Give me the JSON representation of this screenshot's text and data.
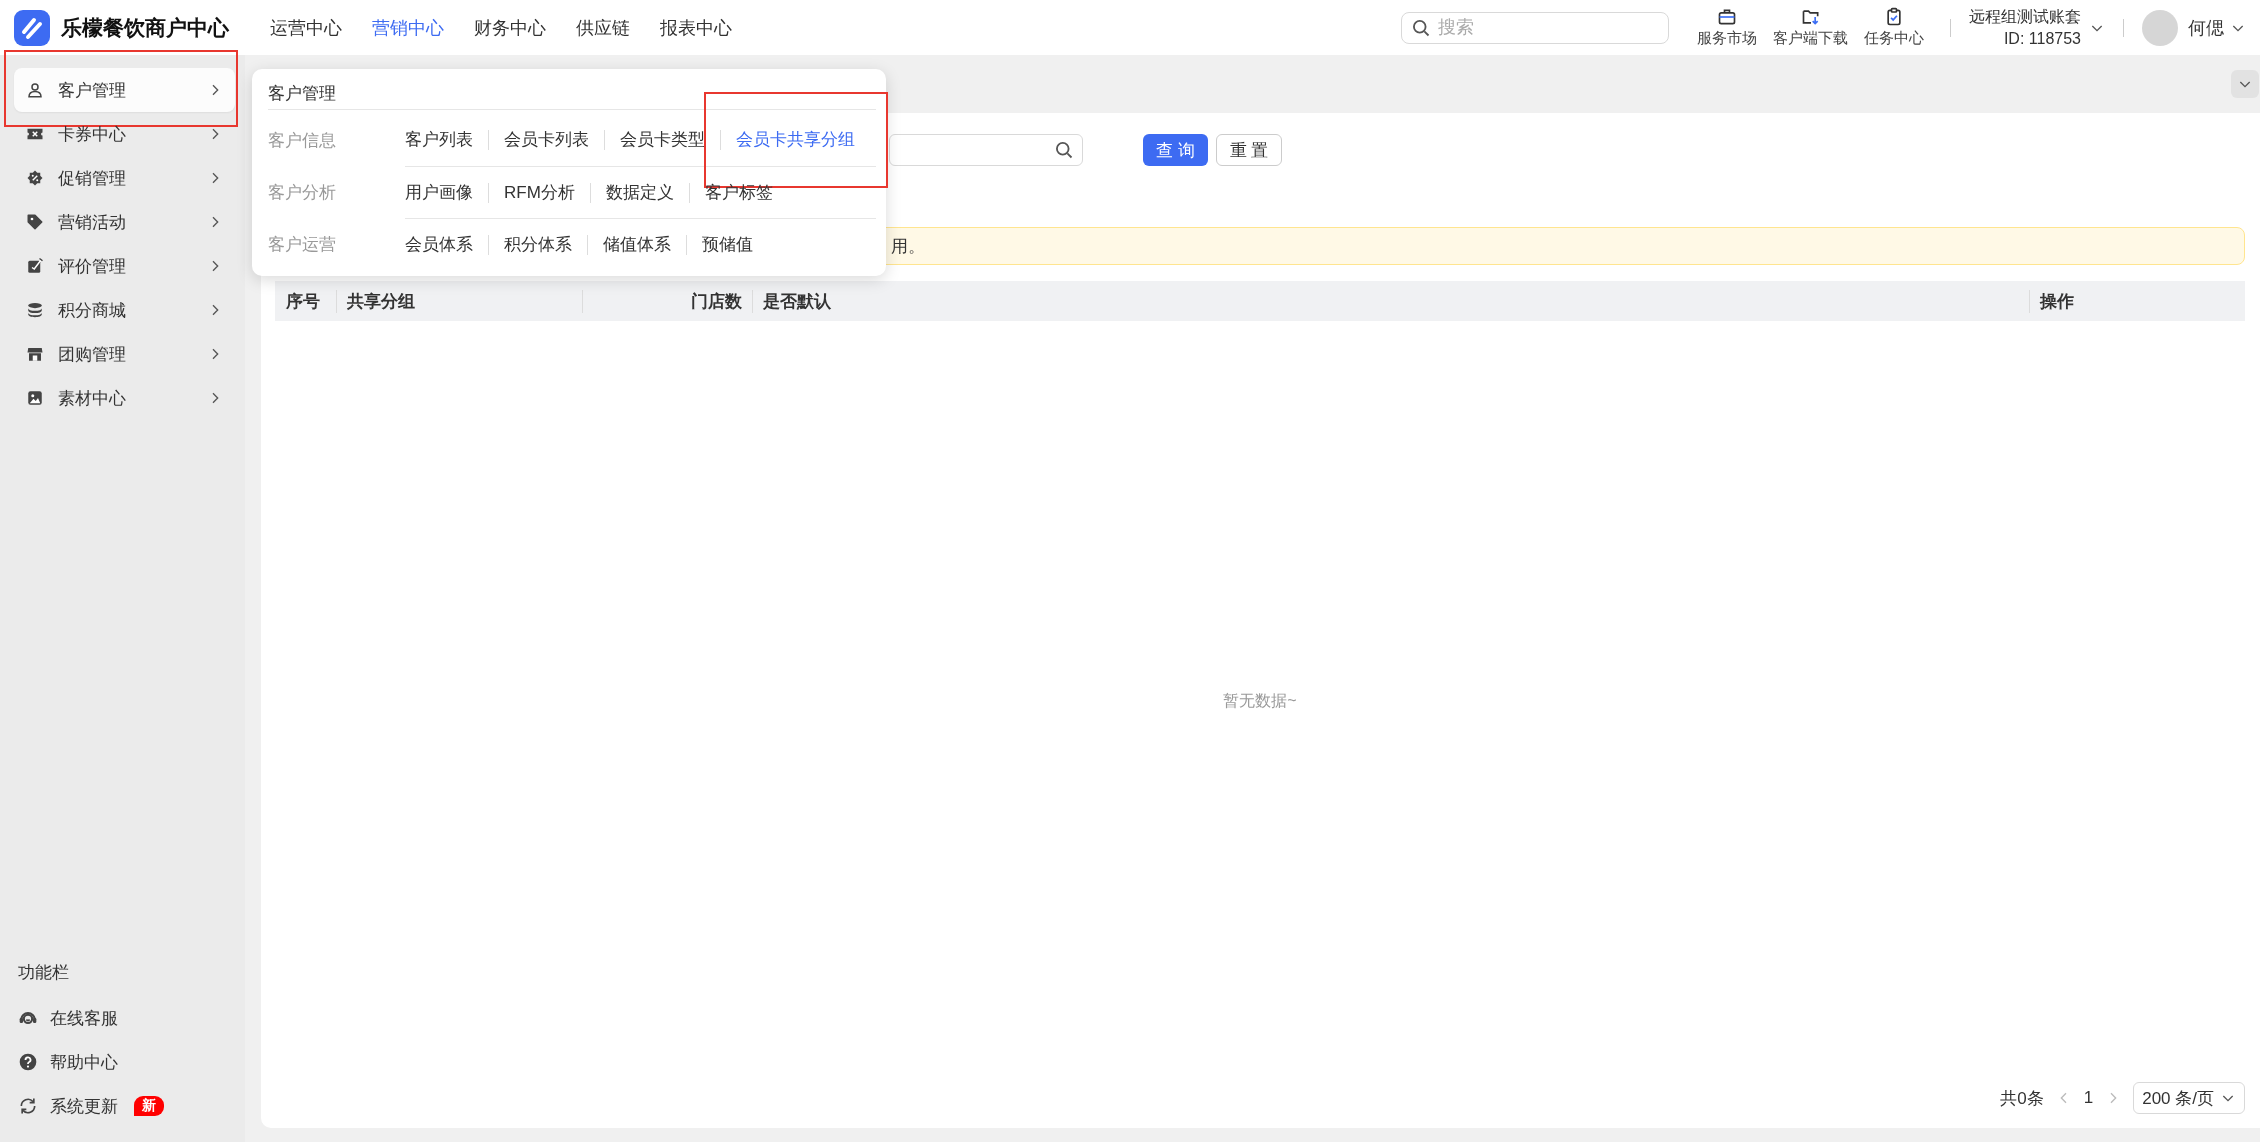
{
  "app": {
    "title": "乐檬餐饮商户中心"
  },
  "nav": [
    {
      "label": "运营中心",
      "selected": false
    },
    {
      "label": "营销中心",
      "selected": true
    },
    {
      "label": "财务中心",
      "selected": false
    },
    {
      "label": "供应链",
      "selected": false
    },
    {
      "label": "报表中心",
      "selected": false
    }
  ],
  "search": {
    "placeholder": "搜索"
  },
  "tools": [
    {
      "label": "服务市场",
      "kind": "briefcase"
    },
    {
      "label": "客户端下载",
      "kind": "download"
    },
    {
      "label": "任务中心",
      "kind": "clipboard"
    }
  ],
  "account": {
    "name": "远程组测试账套",
    "id": "ID: 118753"
  },
  "user": {
    "name": "何偲"
  },
  "sidebar": {
    "items": [
      {
        "label": "客户管理",
        "kind": "user",
        "selected": true,
        "highlighted": true
      },
      {
        "label": "卡券中心",
        "kind": "ticket",
        "selected": false,
        "highlighted": false
      },
      {
        "label": "促销管理",
        "kind": "badge",
        "selected": false,
        "highlighted": false
      },
      {
        "label": "营销活动",
        "kind": "tag",
        "selected": false,
        "highlighted": false
      },
      {
        "label": "评价管理",
        "kind": "edit",
        "selected": false,
        "highlighted": false
      },
      {
        "label": "积分商城",
        "kind": "coins",
        "selected": false,
        "highlighted": false
      },
      {
        "label": "团购管理",
        "kind": "store",
        "selected": false,
        "highlighted": false
      },
      {
        "label": "素材中心",
        "kind": "image",
        "selected": false,
        "highlighted": false
      }
    ],
    "footer_title": "功能栏",
    "footer_items": [
      {
        "label": "在线客服",
        "kind": "headset"
      },
      {
        "label": "帮助中心",
        "kind": "help"
      },
      {
        "label": "系统更新",
        "kind": "refresh",
        "badge": "新"
      }
    ]
  },
  "menu": {
    "title": "客户管理",
    "groups": [
      {
        "label": "客户信息",
        "links": [
          {
            "label": "客户列表",
            "selected": false,
            "highlighted": false
          },
          {
            "label": "会员卡列表",
            "selected": false,
            "highlighted": false
          },
          {
            "label": "会员卡类型",
            "selected": false,
            "highlighted": false
          },
          {
            "label": "会员卡共享分组",
            "selected": true,
            "highlighted": true
          }
        ]
      },
      {
        "label": "客户分析",
        "links": [
          {
            "label": "用户画像",
            "selected": false,
            "highlighted": false
          },
          {
            "label": "RFM分析",
            "selected": false,
            "highlighted": false
          },
          {
            "label": "数据定义",
            "selected": false,
            "highlighted": false
          },
          {
            "label": "客户标签",
            "selected": false,
            "highlighted": false
          }
        ]
      },
      {
        "label": "客户运营",
        "links": [
          {
            "label": "会员体系",
            "selected": false,
            "highlighted": false
          },
          {
            "label": "积分体系",
            "selected": false,
            "highlighted": false
          },
          {
            "label": "储值体系",
            "selected": false,
            "highlighted": false
          },
          {
            "label": "预储值",
            "selected": false,
            "highlighted": false
          }
        ]
      }
    ]
  },
  "filters": {
    "buttons": [
      {
        "label": "查 询",
        "kind": "primary"
      },
      {
        "label": "重 置",
        "kind": "default"
      }
    ]
  },
  "alert": {
    "text": "用。"
  },
  "table": {
    "columns": [
      {
        "label": "序号"
      },
      {
        "label": "共享分组"
      },
      {
        "label": "门店数"
      },
      {
        "label": "是否默认"
      },
      {
        "label": "操作"
      }
    ],
    "empty_text": "暂无数据~"
  },
  "pagination": {
    "total": "共0条",
    "page": "1",
    "page_size": "200 条/页"
  }
}
